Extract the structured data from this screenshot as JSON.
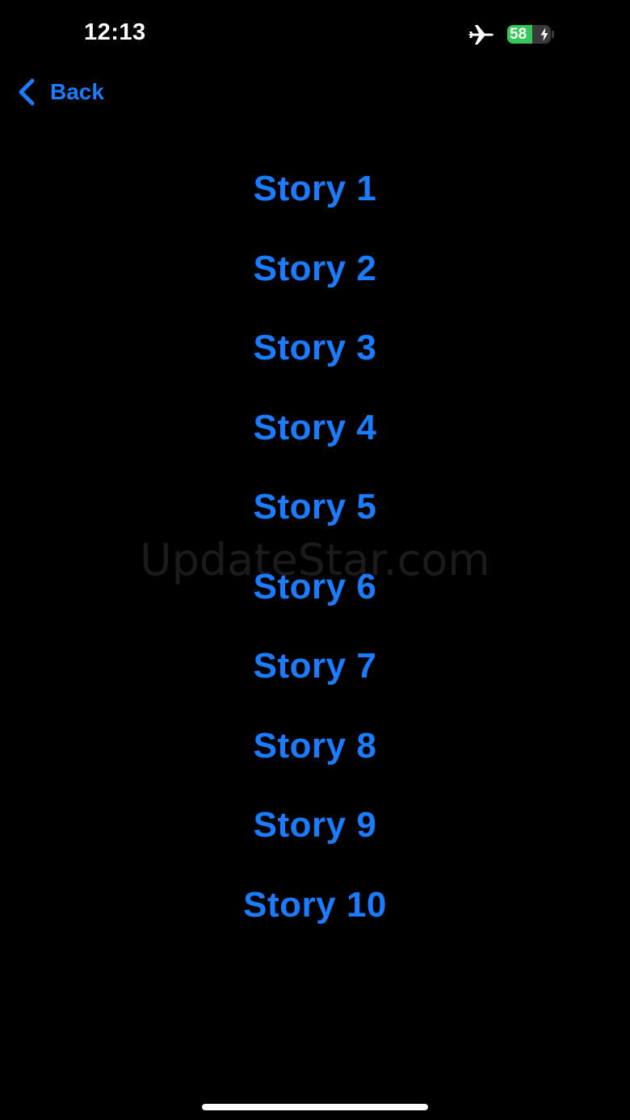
{
  "status_bar": {
    "time": "12:13",
    "battery_percent": "58",
    "battery_level": 0.58,
    "icons": [
      "airplane-icon",
      "battery-icon",
      "charging-bolt-icon"
    ]
  },
  "nav": {
    "back_label": "Back"
  },
  "stories": [
    {
      "label": "Story 1"
    },
    {
      "label": "Story 2"
    },
    {
      "label": "Story 3"
    },
    {
      "label": "Story 4"
    },
    {
      "label": "Story 5"
    },
    {
      "label": "Story 6"
    },
    {
      "label": "Story 7"
    },
    {
      "label": "Story 8"
    },
    {
      "label": "Story 9"
    },
    {
      "label": "Story 10"
    }
  ],
  "watermark": "UpdateStar.com",
  "colors": {
    "background": "#000000",
    "accent": "#1a7cff",
    "battery_fill": "#34c759"
  }
}
